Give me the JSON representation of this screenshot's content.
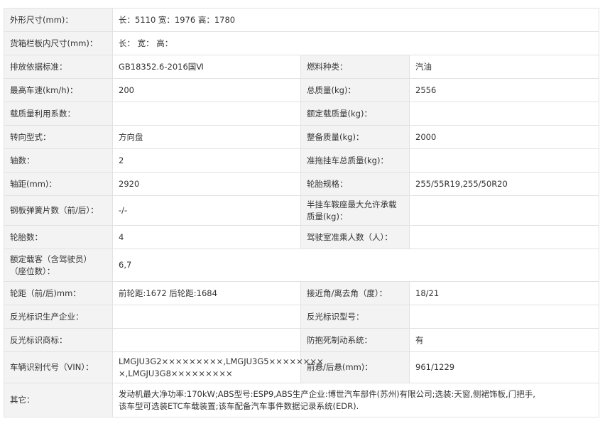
{
  "rows": [
    {
      "type": "wide",
      "label": "外形尺寸(mm)：",
      "value": "长：5110 宽：1976 高：1780"
    },
    {
      "type": "wide",
      "label": "货箱栏板内尺寸(mm)：",
      "value": "长： 宽： 高："
    },
    {
      "type": "pair",
      "label1": "排放依据标准：",
      "value1": "GB18352.6-2016国Ⅵ",
      "label2": "燃料种类：",
      "value2": "汽油"
    },
    {
      "type": "pair",
      "label1": "最高车速(km/h)：",
      "value1": "200",
      "label2": "总质量(kg)：",
      "value2": "2556"
    },
    {
      "type": "pair",
      "label1": "载质量利用系数：",
      "value1": "",
      "label2": "额定载质量(kg)：",
      "value2": ""
    },
    {
      "type": "pair",
      "label1": "转向型式：",
      "value1": "方向盘",
      "label2": "整备质量(kg)：",
      "value2": "2000"
    },
    {
      "type": "pair",
      "label1": "轴数：",
      "value1": "2",
      "label2": "准拖挂车总质量(kg)：",
      "value2": ""
    },
    {
      "type": "pair",
      "label1": "轴距(mm)：",
      "value1": "2920",
      "label2": "轮胎规格：",
      "value2": "255/55R19,255/50R20"
    },
    {
      "type": "pair",
      "label1": "钢板弹簧片数（前/后）：",
      "value1": "-/-",
      "label2a": "半挂车鞍座最大允许承载",
      "label2b": "质量(kg)：",
      "value2": ""
    },
    {
      "type": "pair",
      "label1": "轮胎数：",
      "value1": "4",
      "label2": "驾驶室准乘人数（人）：",
      "value2": ""
    },
    {
      "type": "wide",
      "label_a": "额定载客（含驾驶员）",
      "label_b": "（座位数）：",
      "value": "6,7"
    },
    {
      "type": "pair",
      "label1": "轮距（前/后)mm：",
      "value1": "前轮距:1672 后轮距:1684",
      "label2": "接近角/离去角（度）：",
      "value2": "18/21"
    },
    {
      "type": "pair",
      "label1": "反光标识生产企业：",
      "value1": "",
      "label2": "反光标识型号：",
      "value2": ""
    },
    {
      "type": "pair",
      "label1": "反光标识商标：",
      "value1": "",
      "label2": "防抱死制动系统：",
      "value2": "有"
    },
    {
      "type": "pair",
      "label1": "车辆识别代号（VIN）：",
      "value1a": "LMGJU3G2×××××××××,LMGJU3G5××××××××",
      "value1b": "×,LMGJU3G8×××××××××",
      "label2": "前悬/后悬(mm)：",
      "value2": "961/1229"
    },
    {
      "type": "wide",
      "label": "其它：",
      "value_a": "发动机最大净功率:170kW;ABS型号:ESP9,ABS生产企业:博世汽车部件(苏州)有限公司;选装:天窗,侧裙饰板,门把手,",
      "value_b": "该车型可选装ETC车载装置;该车配备汽车事件数据记录系统(EDR)."
    }
  ]
}
